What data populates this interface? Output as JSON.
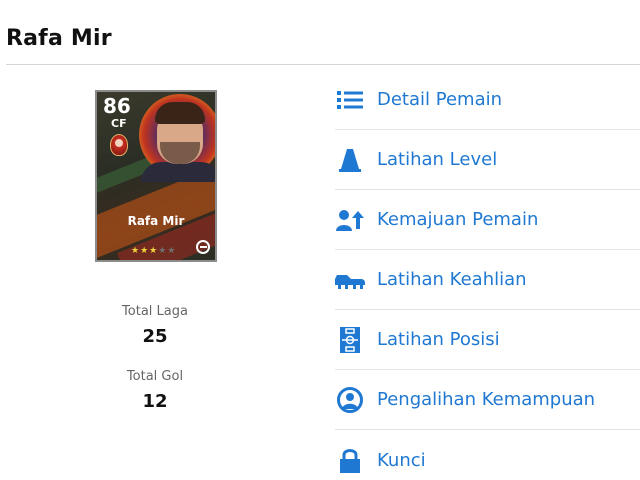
{
  "header": {
    "title": "Rafa Mir"
  },
  "card": {
    "rating": "86",
    "position": "CF",
    "name": "Rafa Mir",
    "stars_filled": 3,
    "stars_total": 5
  },
  "stats": [
    {
      "label": "Total Laga",
      "value": "25"
    },
    {
      "label": "Total Gol",
      "value": "12"
    }
  ],
  "menu": {
    "accent_color": "#1f78d1",
    "items": [
      {
        "label": "Detail Pemain",
        "icon": "list-icon"
      },
      {
        "label": "Latihan Level",
        "icon": "cone-icon"
      },
      {
        "label": "Kemajuan Pemain",
        "icon": "person-up-arrow-icon"
      },
      {
        "label": "Latihan Keahlian",
        "icon": "football-boot-icon"
      },
      {
        "label": "Latihan Posisi",
        "icon": "pitch-icon"
      },
      {
        "label": "Pengalihan Kemampuan",
        "icon": "user-badge-icon"
      },
      {
        "label": "Kunci",
        "icon": "lock-icon"
      }
    ]
  }
}
